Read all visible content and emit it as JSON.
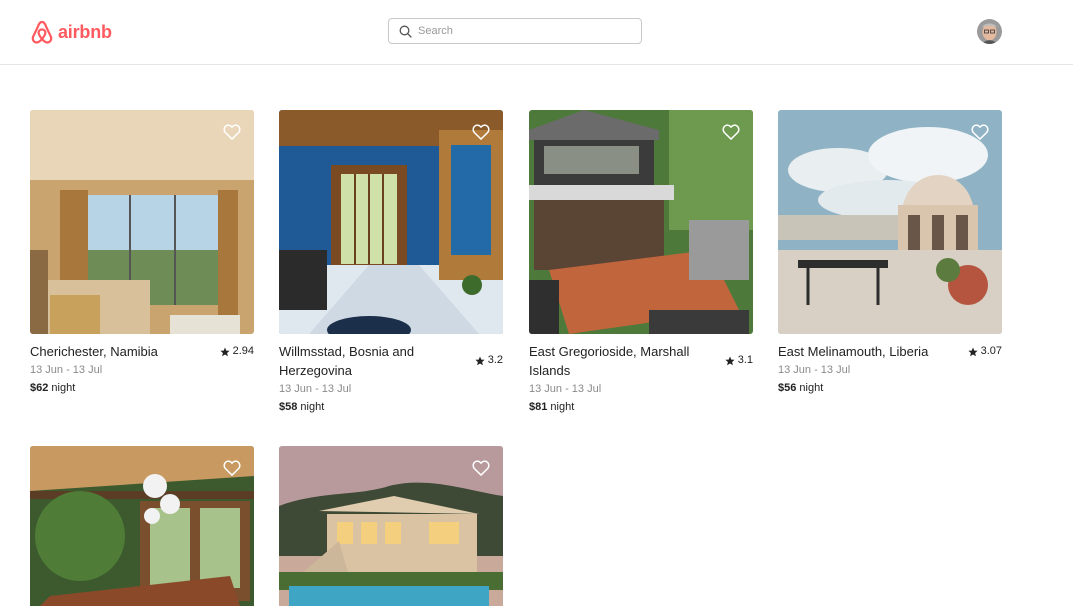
{
  "header": {
    "logo_text": "airbnb",
    "search": {
      "placeholder": "Search",
      "value": ""
    }
  },
  "listings": [
    {
      "title": "Cherichester, Namibia",
      "rating": "2.94",
      "dates": "13 Jun - 13 Jul",
      "price": "$62",
      "unit": "night"
    },
    {
      "title": "Willmsstad, Bosnia and Herzegovina",
      "rating": "3.2",
      "dates": "13 Jun - 13 Jul",
      "price": "$58",
      "unit": "night"
    },
    {
      "title": "East Gregorioside, Marshall Islands",
      "rating": "3.1",
      "dates": "13 Jun - 13 Jul",
      "price": "$81",
      "unit": "night"
    },
    {
      "title": "East Melinamouth, Liberia",
      "rating": "3.07",
      "dates": "13 Jun - 13 Jul",
      "price": "$56",
      "unit": "night"
    },
    {
      "title": "",
      "rating": "",
      "dates": "",
      "price": "",
      "unit": ""
    },
    {
      "title": "",
      "rating": "",
      "dates": "",
      "price": "",
      "unit": ""
    }
  ],
  "colors": {
    "brand": "#ff5a5f",
    "text": "#222222",
    "muted": "#8a8a8a",
    "border": "#e6e6e6"
  },
  "icons": [
    "airbnb-logo-icon",
    "search-icon",
    "heart-icon",
    "star-icon",
    "avatar"
  ]
}
